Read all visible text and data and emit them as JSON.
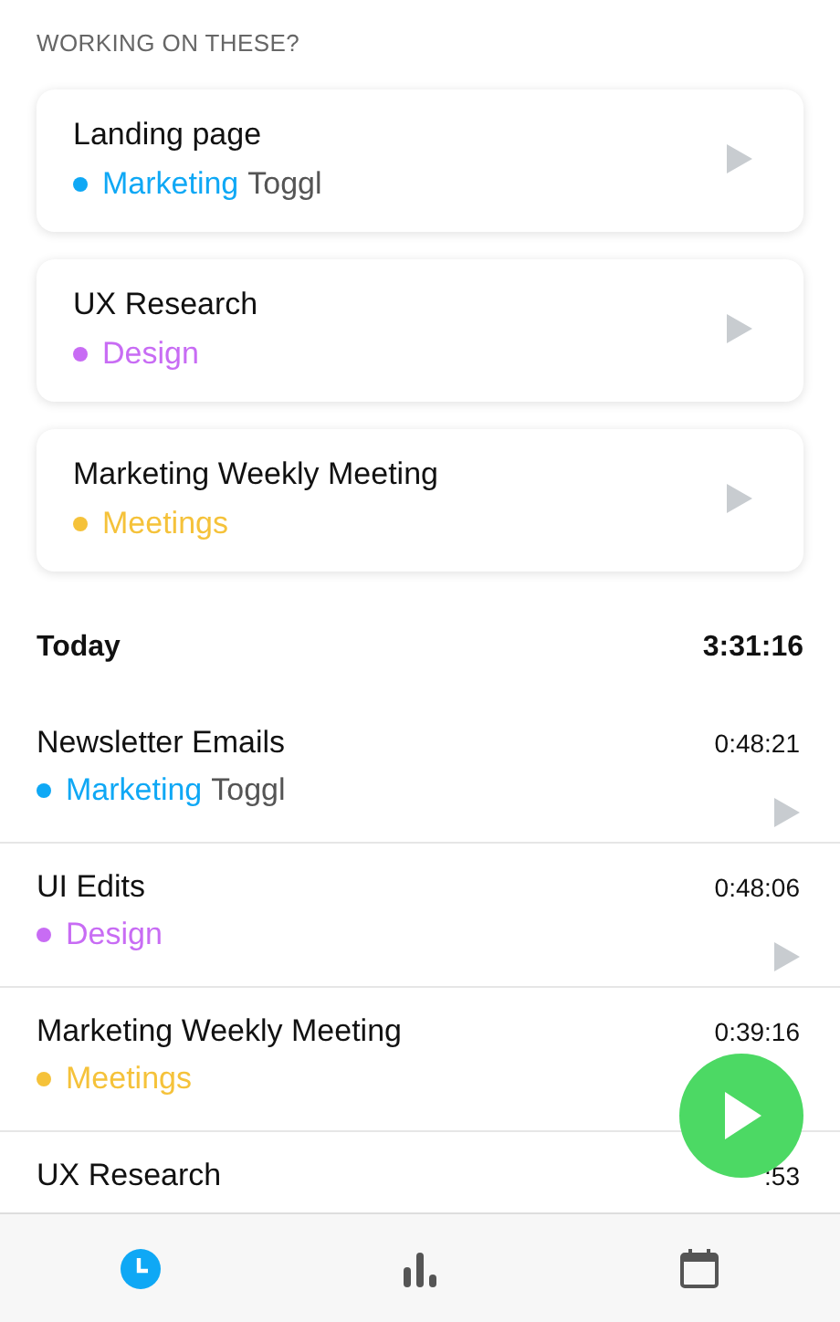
{
  "suggestions_header": "WORKING ON THESE?",
  "suggestions": [
    {
      "title": "Landing page",
      "project": "Marketing",
      "client": "Toggl",
      "color": "#0fa8f5"
    },
    {
      "title": "UX Research",
      "project": "Design",
      "color": "#c86cf4"
    },
    {
      "title": "Marketing Weekly Meeting",
      "project": "Meetings",
      "color": "#f5c23a"
    }
  ],
  "day": {
    "label": "Today",
    "total": "3:31:16"
  },
  "entries": [
    {
      "title": "Newsletter Emails",
      "duration": "0:48:21",
      "project": "Marketing",
      "client": "Toggl",
      "color": "#0fa8f5",
      "play_visible": true
    },
    {
      "title": "UI Edits",
      "duration": "0:48:06",
      "project": "Design",
      "color": "#c86cf4",
      "play_visible": true
    },
    {
      "title": "Marketing Weekly Meeting",
      "duration": "0:39:16",
      "project": "Meetings",
      "color": "#f5c23a",
      "play_visible": false
    },
    {
      "title": "UX Research",
      "duration": ":53"
    }
  ],
  "tabs": [
    {
      "kind": "timer",
      "selected": true
    },
    {
      "kind": "reports",
      "selected": false
    },
    {
      "kind": "calendar",
      "selected": false
    }
  ]
}
